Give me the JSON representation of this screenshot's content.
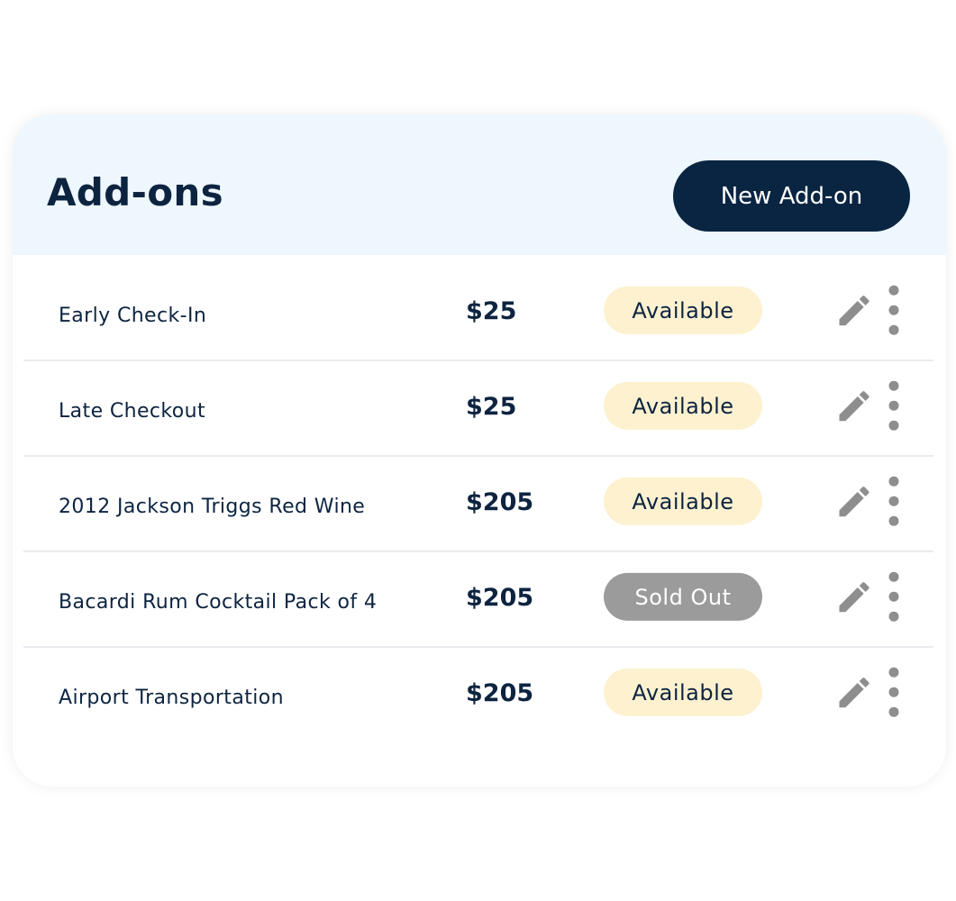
{
  "header": {
    "title": "Add-ons",
    "new_button_label": "New Add-on"
  },
  "addons": [
    {
      "name": "Early Check-In",
      "price": "$25",
      "status": "Available"
    },
    {
      "name": "Late Checkout",
      "price": "$25",
      "status": "Available"
    },
    {
      "name": "2012 Jackson Triggs Red Wine",
      "price": "$205",
      "status": "Available"
    },
    {
      "name": "Bacardi Rum Cocktail Pack of 4",
      "price": "$205",
      "status": "Sold Out"
    },
    {
      "name": "Airport Transportation",
      "price": "$205",
      "status": "Available"
    }
  ],
  "icons": {
    "edit": "pencil-icon",
    "more": "vertical-ellipsis-icon"
  },
  "colors": {
    "primary_dark": "#0a2542",
    "header_bg": "#eef7fd",
    "available_bg": "#fdf1cf",
    "sold_out_bg": "#9b9b9b",
    "icon_gray": "#8e8e8e"
  }
}
